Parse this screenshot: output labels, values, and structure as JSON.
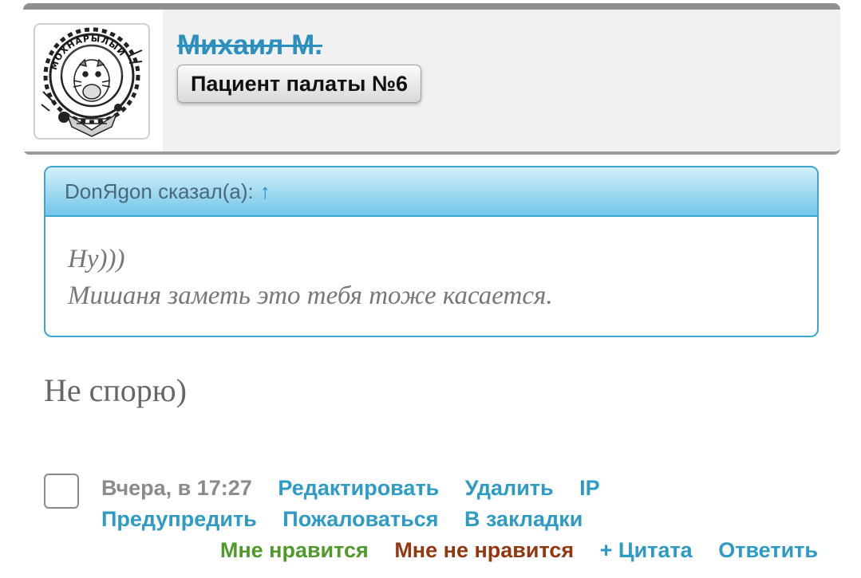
{
  "author": {
    "name": "Михаил М.",
    "title": "Пациент палаты №6",
    "avatar": {
      "icon": "badge-medal-icon",
      "badge_text": "МОХНАРЫЛЫЙ"
    }
  },
  "quote": {
    "header": "DonЯgon сказал(а):",
    "arrow": "↑",
    "lines": [
      "Ну)))",
      "Мишаня заметь это тебя тоже касается."
    ]
  },
  "message": {
    "text": "Не спорю)"
  },
  "footer": {
    "timestamp": "Вчера, в 17:27",
    "actions": {
      "edit": "Редактировать",
      "delete": "Удалить",
      "ip": "IP",
      "warn": "Предупредить",
      "report": "Пожаловаться",
      "bookmark": "В закладки",
      "like": "Мне нравится",
      "dislike": "Мне не нравится",
      "quote": "+ Цитата",
      "reply": "Ответить"
    }
  },
  "colors": {
    "link": "#2e9ac6",
    "username": "#2b8fbf",
    "like": "#4f9a2a",
    "dislike": "#93380e",
    "quote_border": "#3da6cf"
  }
}
